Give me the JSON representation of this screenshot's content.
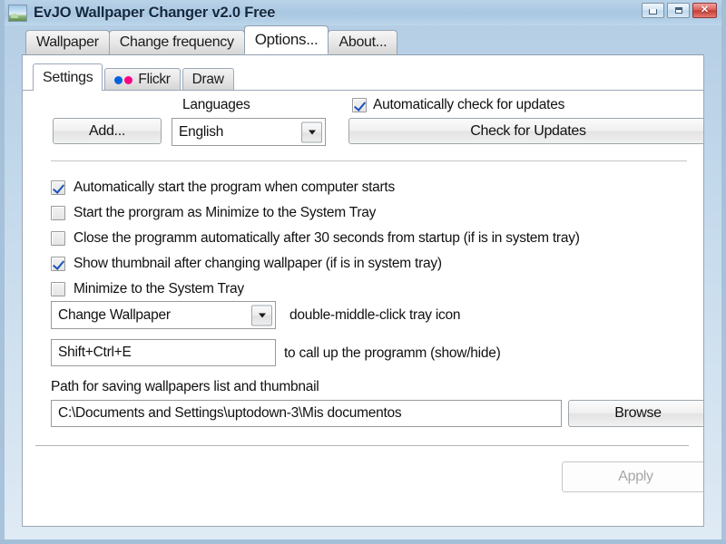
{
  "window": {
    "title": "EvJO Wallpaper Changer v2.0 Free",
    "app_icon": "picture-icon",
    "controls": [
      {
        "name": "minimize",
        "label": "Minimize"
      },
      {
        "name": "maximize",
        "label": "Maximize"
      },
      {
        "name": "close",
        "label": "Close"
      }
    ]
  },
  "outer_tabs": [
    {
      "label": "Wallpaper",
      "active": false
    },
    {
      "label": "Change frequency",
      "active": false
    },
    {
      "label": "Options...",
      "active": true
    },
    {
      "label": "About...",
      "active": false
    }
  ],
  "inner_tabs": [
    {
      "label": "Settings",
      "active": true,
      "icon": ""
    },
    {
      "label": "Flickr",
      "active": false,
      "icon": "flickr-dots-icon"
    },
    {
      "label": "Draw",
      "active": false,
      "icon": ""
    }
  ],
  "languages": {
    "label": "Languages",
    "add_button": "Add...",
    "selected": "English",
    "dropdown_icon": "chevron-down-icon"
  },
  "updates": {
    "auto_check_label": "Automatically check for updates",
    "auto_check_checked": true,
    "check_button": "Check for Updates"
  },
  "options": [
    {
      "label": "Automatically start the program when computer starts",
      "checked": true
    },
    {
      "label": "Start the prorgram as Minimize to the System Tray",
      "checked": false
    },
    {
      "label": "Close the programm automatically after 30 seconds from startup  (if is in system tray)",
      "checked": false
    },
    {
      "label": "Show thumbnail after changing wallpaper (if is in system tray)",
      "checked": true
    },
    {
      "label": "Minimize to the System Tray",
      "checked": false
    }
  ],
  "tray_action": {
    "selected": "Change Wallpaper",
    "caption": "double-middle-click tray icon",
    "dropdown_icon": "chevron-down-icon"
  },
  "hotkey": {
    "value": "Shift+Ctrl+E",
    "caption": "to call up the programm (show/hide)"
  },
  "path": {
    "label": "Path for saving wallpapers list and thumbnail",
    "value": "C:\\Documents and Settings\\uptodown-3\\Mis documentos",
    "browse_button": "Browse"
  },
  "footer": {
    "apply_button": "Apply",
    "apply_disabled": true
  },
  "colors": {
    "flickr_blue": "#0063db",
    "flickr_pink": "#ff0084",
    "checkmark": "#1a52b8",
    "close_button": "#c53c33",
    "titlebar": "#a9c7e2"
  }
}
